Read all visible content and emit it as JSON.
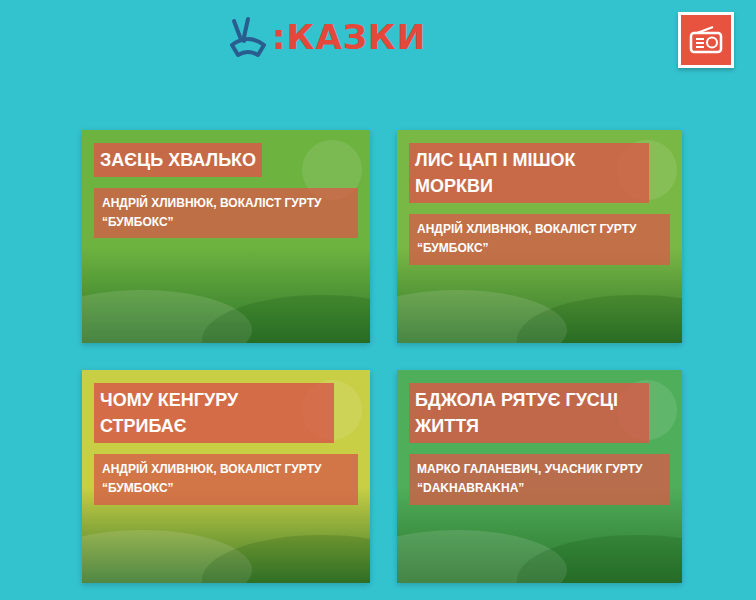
{
  "logo": {
    "text": ":КАЗКИ"
  },
  "cards": [
    {
      "title": "ЗАЄЦЬ ХВАЛЬКО",
      "author": "АНДРІЙ ХЛИВНЮК, ВОКАЛІСТ ГУРТУ “БУМБОКС”",
      "color": "#6db340"
    },
    {
      "title": "ЛИС ЦАП І МІШОК МОРКВИ",
      "author": "АНДРІЙ ХЛИВНЮК, ВОКАЛІСТ ГУРТУ “БУМБОКС”",
      "color": "#7ab845"
    },
    {
      "title": "ЧОМУ КЕНГУРУ СТРИБАЄ",
      "author": "АНДРІЙ ХЛИВНЮК, ВОКАЛІСТ ГУРТУ “БУМБОКС”",
      "color": "#c8cf45"
    },
    {
      "title": "БДЖОЛА РЯТУЄ ГУСЦІ ЖИТТЯ",
      "author": "МАРКО ГАЛАНЕВИЧ, УЧАСНИК ГУРТУ “DAKHABRAKHA”",
      "color": "#4fae5a"
    }
  ]
}
